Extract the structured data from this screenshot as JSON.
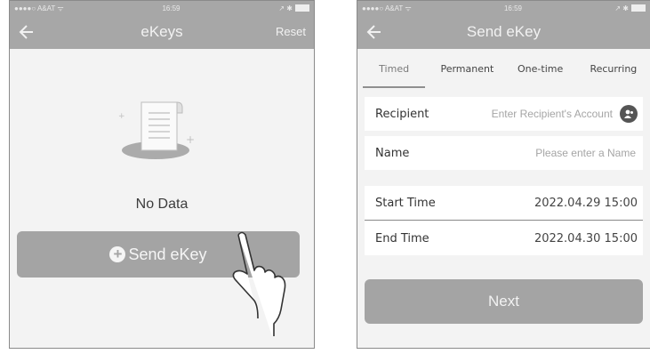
{
  "left_screen": {
    "status": {
      "carrier": "●●●●○ A&AT ᯤ",
      "time": "16:59",
      "icons": "↗ ✱"
    },
    "header": {
      "title": "eKeys",
      "reset_label": "Reset"
    },
    "empty_state": {
      "message": "No Data"
    },
    "send_button_label": "Send eKey"
  },
  "right_screen": {
    "status": {
      "carrier": "●●●●○ A&AT ᯤ",
      "time": "16:59",
      "icons": "↗ ✱"
    },
    "header": {
      "title": "Send eKey"
    },
    "tabs": [
      {
        "label": "Timed",
        "active": true
      },
      {
        "label": "Permanent",
        "active": false
      },
      {
        "label": "One-time",
        "active": false
      },
      {
        "label": "Recurring",
        "active": false
      }
    ],
    "form": {
      "recipient_label": "Recipient",
      "recipient_placeholder": "Enter Recipient's Account",
      "name_label": "Name",
      "name_placeholder": "Please enter a Name",
      "start_label": "Start Time",
      "start_value": "2022.04.29 15:00",
      "end_label": "End Time",
      "end_value": "2022.04.30 15:00"
    },
    "next_label": "Next"
  }
}
